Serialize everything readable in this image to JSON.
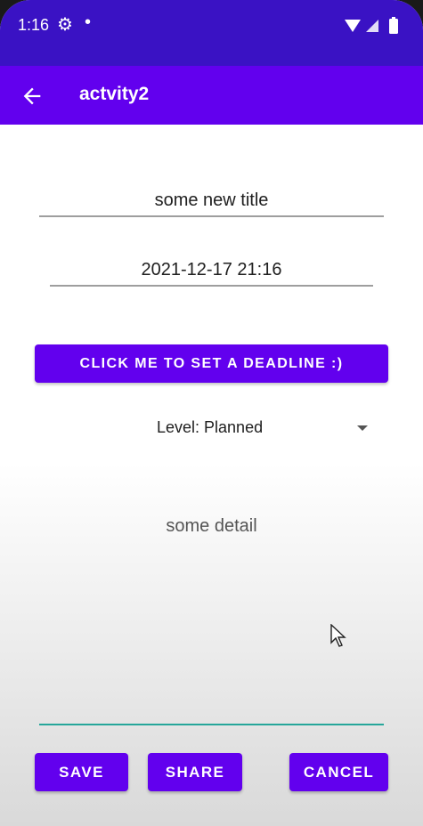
{
  "status_bar": {
    "time": "1:16",
    "gear_icon": "gear-icon",
    "notification_dot": "•"
  },
  "app_bar": {
    "title": "actvity2",
    "back_icon": "arrow-back-icon",
    "color": "#6200ee"
  },
  "form": {
    "title_value": "some new title",
    "date_value": "2021-12-17 21:16",
    "deadline_button_label": "CLICK ME TO SET A DEADLINE :)",
    "level_spinner": "Level: Planned",
    "detail_value": "some detail"
  },
  "actions": {
    "save_label": "SAVE",
    "share_label": "SHARE",
    "cancel_label": "CANCEL"
  },
  "colors": {
    "primary": "#6200ee",
    "status_bar": "#3a12c4",
    "accent_underline": "#26a69a"
  }
}
